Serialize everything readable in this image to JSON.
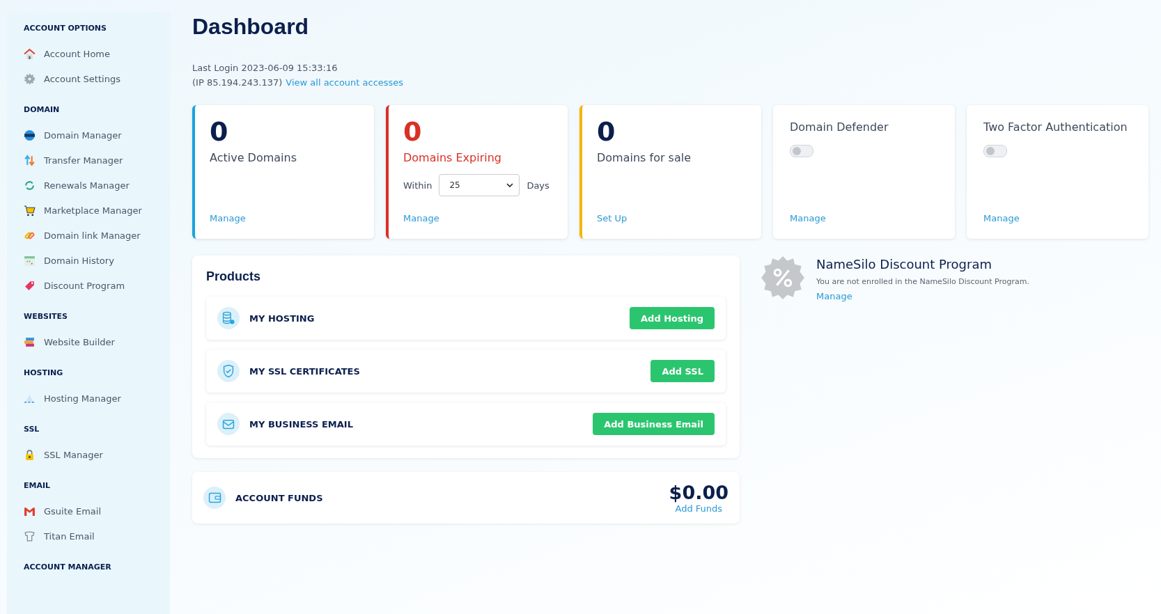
{
  "sidebar": {
    "sections": [
      {
        "heading": "ACCOUNT OPTIONS",
        "items": [
          "Account Home",
          "Account Settings"
        ]
      },
      {
        "heading": "DOMAIN",
        "items": [
          "Domain Manager",
          "Transfer Manager",
          "Renewals Manager",
          "Marketplace Manager",
          "Domain link Manager",
          "Domain History",
          "Discount Program"
        ]
      },
      {
        "heading": "WEBSITES",
        "items": [
          "Website Builder"
        ]
      },
      {
        "heading": "HOSTING",
        "items": [
          "Hosting Manager"
        ]
      },
      {
        "heading": "SSL",
        "items": [
          "SSL Manager"
        ]
      },
      {
        "heading": "EMAIL",
        "items": [
          "Gsuite Email",
          "Titan Email"
        ]
      },
      {
        "heading": "ACCOUNT MANAGER"
      }
    ]
  },
  "page": {
    "title": "Dashboard",
    "last_login": "Last Login 2023-06-09 15:33:16",
    "ip": "(IP 85.194.243.137)",
    "accesses_link": "View all account accesses"
  },
  "stat_cards": [
    {
      "kind": "count",
      "color": "#1aa3dd",
      "number": "0",
      "label": "Active Domains",
      "link": "Manage"
    },
    {
      "kind": "expiring",
      "color": "#d93025",
      "number": "0",
      "label": "Domains Expiring",
      "within": "Within",
      "select_value": "25",
      "days": "Days",
      "link": "Manage"
    },
    {
      "kind": "count",
      "color": "#f5b50a",
      "number": "0",
      "label": "Domains for sale",
      "link": "Set Up"
    },
    {
      "kind": "toggle",
      "label": "Domain Defender",
      "on": false,
      "link": "Manage"
    },
    {
      "kind": "toggle",
      "label": "Two Factor Authentication",
      "on": false,
      "link": "Manage"
    }
  ],
  "products": {
    "title": "Products",
    "rows": [
      {
        "label": "MY HOSTING",
        "button": "Add Hosting"
      },
      {
        "label": "MY SSL CERTIFICATES",
        "button": "Add SSL"
      },
      {
        "label": "MY BUSINESS EMAIL",
        "button": "Add Business Email"
      }
    ]
  },
  "funds": {
    "label": "ACCOUNT FUNDS",
    "amount": "$0.00",
    "link": "Add Funds"
  },
  "discount": {
    "title": "NameSilo Discount Program",
    "text": "You are not enrolled in the NameSilo Discount Program.",
    "link": "Manage"
  }
}
